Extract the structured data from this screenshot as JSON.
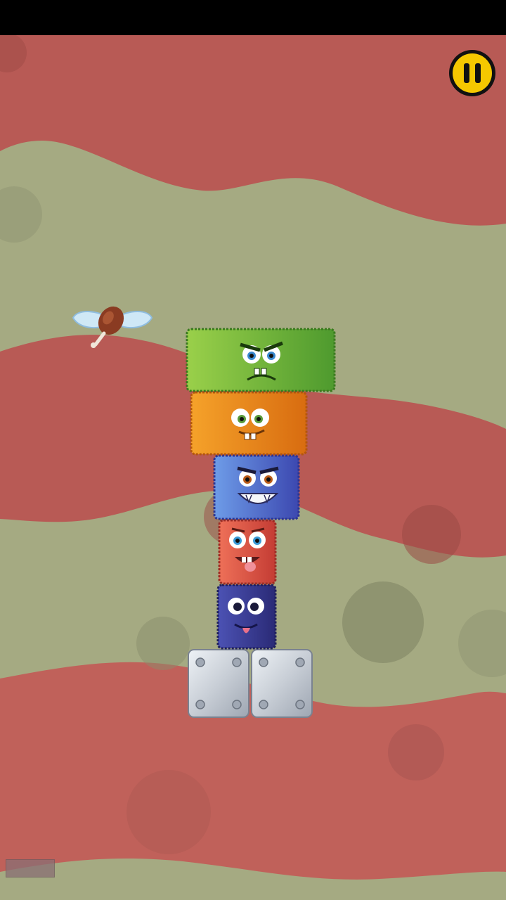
{
  "game": {
    "title": "",
    "pause_icon": "pause-icon",
    "colors": {
      "background_red": "#b85a55",
      "background_green": "#a5aa82",
      "pause_yellow": "#f5c800",
      "monster_green": "#7cc240",
      "monster_orange": "#ee8a1c",
      "monster_blue": "#5870d0",
      "monster_red": "#de5a48",
      "monster_navy": "#3a3c94",
      "metal_block": "#c8ced6"
    },
    "tower": [
      {
        "name": "green-monster",
        "mood": "angry"
      },
      {
        "name": "orange-monster",
        "mood": "goofy"
      },
      {
        "name": "blue-monster",
        "mood": "grinning"
      },
      {
        "name": "red-monster",
        "mood": "silly"
      },
      {
        "name": "navy-monster",
        "mood": "cheeky"
      }
    ],
    "base_blocks": [
      "metal-block",
      "metal-block"
    ],
    "flying_item": "winged-drumstick-icon"
  }
}
